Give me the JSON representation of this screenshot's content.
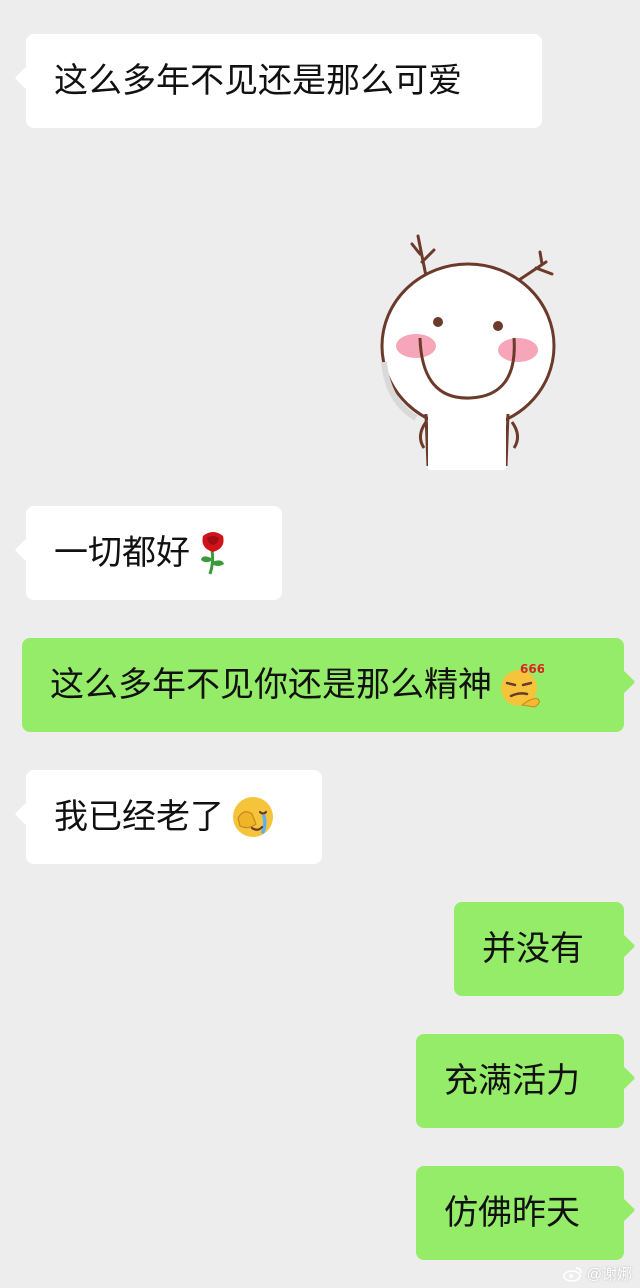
{
  "chat": {
    "messages": [
      {
        "side": "left",
        "type": "text",
        "text": "这么多年不见还是那么可爱"
      },
      {
        "side": "left",
        "type": "sticker",
        "sticker": "smiling-doll-sticker"
      },
      {
        "side": "left",
        "type": "text",
        "text": "一切都好",
        "emoji": "rose-icon"
      },
      {
        "side": "right",
        "type": "text",
        "text": "这么多年不见你还是那么精神",
        "emoji": "666-smirk-icon",
        "emoji_text": "666"
      },
      {
        "side": "left",
        "type": "text",
        "text": "我已经老了",
        "emoji": "facepalm-cry-icon"
      },
      {
        "side": "right",
        "type": "text",
        "text": "并没有"
      },
      {
        "side": "right",
        "type": "text",
        "text": "充满活力"
      },
      {
        "side": "right",
        "type": "text",
        "text": "仿佛昨天"
      }
    ]
  },
  "watermark": {
    "text": "@谢娜",
    "icon": "weibo-icon"
  },
  "colors": {
    "background": "#ededed",
    "incoming_bubble": "#ffffff",
    "outgoing_bubble": "#95ec69",
    "text": "#111111"
  }
}
